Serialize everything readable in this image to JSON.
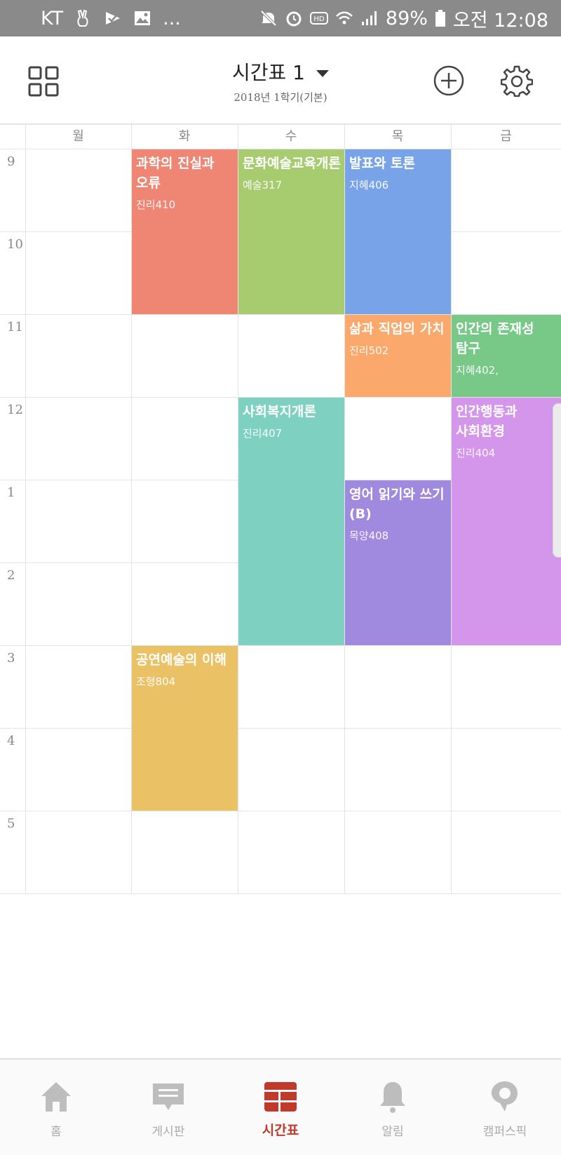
{
  "status_bar": {
    "carrier": "KT",
    "more": "...",
    "battery": "89%",
    "time": "오전 12:08"
  },
  "header": {
    "title": "시간표 1",
    "subtitle": "2018년 1학기(기본)",
    "icons": [
      "grid-icon",
      "caret-down-icon",
      "plus-circle-icon",
      "gear-icon"
    ]
  },
  "timetable": {
    "days": [
      "월",
      "화",
      "수",
      "목",
      "금"
    ],
    "hours": [
      "9",
      "10",
      "11",
      "12",
      "1",
      "2",
      "3",
      "4",
      "5"
    ],
    "courses": [
      {
        "name": "과학의 진실과 오류",
        "room": "진리410",
        "day": 1,
        "start": 9,
        "end": 11,
        "color": "#ef8674"
      },
      {
        "name": "문화예술교육개론",
        "room": "예술317",
        "day": 2,
        "start": 9,
        "end": 11,
        "color": "#a7cb6f"
      },
      {
        "name": "발표와 토론",
        "room": "지혜406",
        "day": 3,
        "start": 9,
        "end": 11,
        "color": "#78a3e8"
      },
      {
        "name": "삶과 직업의 가치",
        "room": "진리502",
        "day": 3,
        "start": 11,
        "end": 12,
        "color": "#fba86c"
      },
      {
        "name": "인간의 존재성 탐구",
        "room": "지혜402,",
        "day": 4,
        "start": 11,
        "end": 12,
        "color": "#78c888"
      },
      {
        "name": "사회복지개론",
        "room": "진리407",
        "day": 2,
        "start": 12,
        "end": 15,
        "color": "#7ed0c0"
      },
      {
        "name": "인간행동과 사회환경",
        "room": "진리404",
        "day": 4,
        "start": 12,
        "end": 15,
        "color": "#d496ea"
      },
      {
        "name": "영어 읽기와 쓰기(B)",
        "room": "목양408",
        "day": 3,
        "start": 13,
        "end": 15,
        "color": "#9f8ae0"
      },
      {
        "name": "공연예술의 이해",
        "room": "조형804",
        "day": 1,
        "start": 15,
        "end": 17,
        "color": "#ebc166"
      }
    ]
  },
  "bottom_nav": [
    {
      "label": "홈",
      "icon": "home-icon",
      "active": false
    },
    {
      "label": "게시판",
      "icon": "board-icon",
      "active": false
    },
    {
      "label": "시간표",
      "icon": "timetable-icon",
      "active": true
    },
    {
      "label": "알림",
      "icon": "bell-icon",
      "active": false
    },
    {
      "label": "캠퍼스픽",
      "icon": "campuspick-icon",
      "active": false
    }
  ],
  "colors": {
    "active_tab": "#c0392b",
    "inactive_tab": "#bdbdbd",
    "status_bar_bg": "#8a8a8a"
  }
}
